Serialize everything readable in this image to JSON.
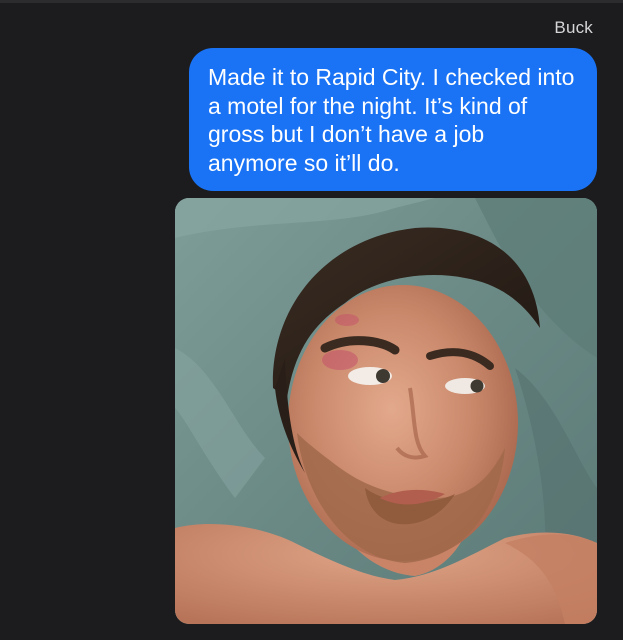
{
  "thread": {
    "sender_name": "Buck"
  },
  "messages": [
    {
      "type": "text",
      "text": "Made it to Rapid City. I checked into a motel for the night. It’s kind of gross but I don’t have a job anymore so it’ll do.",
      "bubble_color": "#1a73f5"
    },
    {
      "type": "image",
      "image_subject": "selfie"
    }
  ],
  "colors": {
    "background": "#1c1c1e",
    "bubble": "#1a73f5",
    "sender_name_text": "#d6d6d8"
  }
}
